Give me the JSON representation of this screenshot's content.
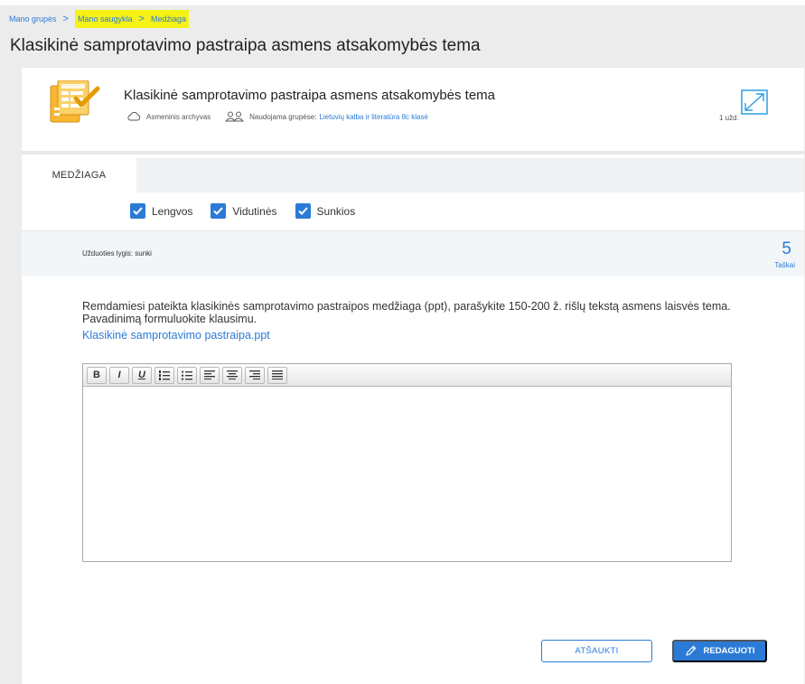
{
  "breadcrumb": {
    "home": "Mano grupės",
    "storage": "Mano saugykla",
    "current": "Medžiaga",
    "separator": ">"
  },
  "page": {
    "title": "Klasikinė samprotavimo pastraipa asmens atsakomybės tema"
  },
  "material": {
    "title": "Klasikinė samprotavimo pastraipa asmens atsakomybės tema",
    "archive_label": "Asmeninis archyvas",
    "usage_label": "Naudojama grupėse:",
    "group_link": "Lietuvių kalba ir literatūra 8c klasė",
    "task_count": "1 užd."
  },
  "tabs": [
    {
      "label": "MEDŽIAGA",
      "active": true
    }
  ],
  "filters": [
    {
      "label": "Lengvos",
      "checked": true
    },
    {
      "label": "Vidutinės",
      "checked": true
    },
    {
      "label": "Sunkios",
      "checked": true
    }
  ],
  "task": {
    "level_text": "Užduoties lygis: sunki",
    "points": "5",
    "points_label": "Taškai",
    "instruction": "Remdamiesi pateikta klasikinės samprotavimo pastraipos medžiaga (ppt), parašykite 150-200 ž. rišlų tekstą asmens laisvės tema. Pavadinimą formuluokite klausimu.",
    "file_link": "Klasikinė samprotavimo pastraipa.ppt"
  },
  "editor": {
    "bold": "B",
    "italic": "I",
    "underline": "U",
    "value": ""
  },
  "actions": {
    "cancel": "ATŠAUKTI",
    "edit": "REDAGUOTI"
  },
  "colors": {
    "accent": "#2b7bd6",
    "highlight": "#f6f216"
  }
}
